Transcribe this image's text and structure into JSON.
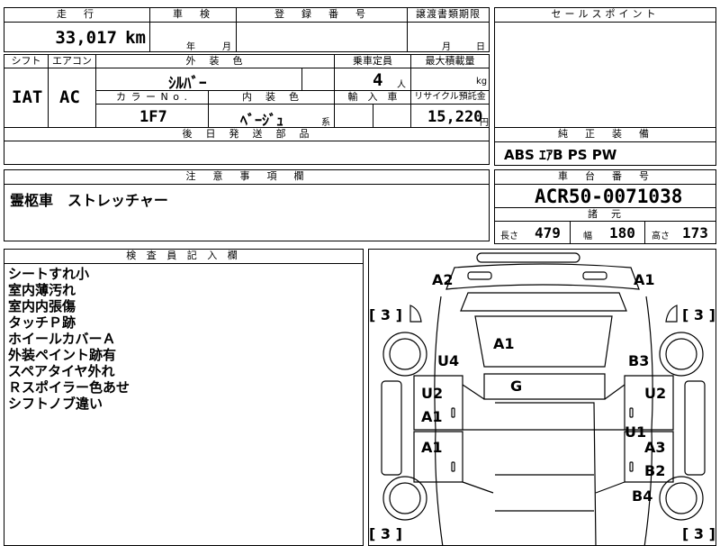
{
  "header": {
    "mileage_label": "走　行",
    "inspection_label": "車　検",
    "reg_label": "登　録　番　号",
    "transfer_label": "譲渡書類期限",
    "selling_label": "セールスポイント",
    "mileage_value": "33,017",
    "mileage_unit": "km",
    "year_unit": "年",
    "month_unit": "月",
    "transfer_month": "月",
    "transfer_day": "日"
  },
  "spec": {
    "shift_label": "シフト",
    "ac_label": "エアコン",
    "exterior_label": "外　装　色",
    "capacity_label": "乗車定員",
    "maxload_label": "最大積載量",
    "shift_value": "IAT",
    "ac_value": "AC",
    "exterior_value": "ｼﾙﾊﾞｰ",
    "capacity_value": "4",
    "capacity_unit": "人",
    "load_unit": "kg",
    "color_no_label": "カ ラ ー N o .",
    "interior_label": "内　装　色",
    "import_label": "輸　入　車",
    "recycle_label": "リサイクル預託金",
    "color_no_value": "1F7",
    "interior_value": "ﾍﾞｰｼﾞｭ",
    "interior_suffix": "系",
    "recycle_value": "15,220",
    "recycle_unit": "円",
    "later_parts_label": "後　日　発　送　部　品"
  },
  "equipment": {
    "label": "純　正　装　備",
    "value": "ABS ｴｱB PS PW"
  },
  "notes": {
    "label": "注　意　事　項　欄",
    "value": "霊柩車　ストレッチャー"
  },
  "chassis": {
    "label": "車　台　番　号",
    "value": "ACR50-0071038",
    "specs_label": "諸　元",
    "length_label": "長さ",
    "length_value": "479",
    "width_label": "幅",
    "width_value": "180",
    "height_label": "高さ",
    "height_value": "173"
  },
  "inspector": {
    "label": "検 査 員 記 入 欄",
    "lines": [
      "シートすれ小",
      "室内薄汚れ",
      "室内内張傷",
      "タッチＰ跡",
      "ホイールカバーＡ",
      "外装ペイント跡有",
      "スペアタイヤ外れ",
      "Ｒスポイラー色あせ",
      "シフトノブ違い"
    ]
  },
  "diagram": {
    "marks": {
      "a2_front_left": "A2",
      "a1_front_right": "A1",
      "bracket_tl": "[ 3 ]",
      "bracket_tr": "[ 3 ]",
      "bracket_bl": "[ 3 ]",
      "bracket_br": "[ 3 ]",
      "a1_roof": "A1",
      "u4": "U4",
      "b3": "B3",
      "g": "G",
      "u2_left": "U2",
      "u2_right": "U2",
      "a1_left_door": "A1",
      "u1": "U1",
      "a1_left_rear": "A1",
      "a3": "A3",
      "b2": "B2",
      "b4": "B4"
    }
  }
}
